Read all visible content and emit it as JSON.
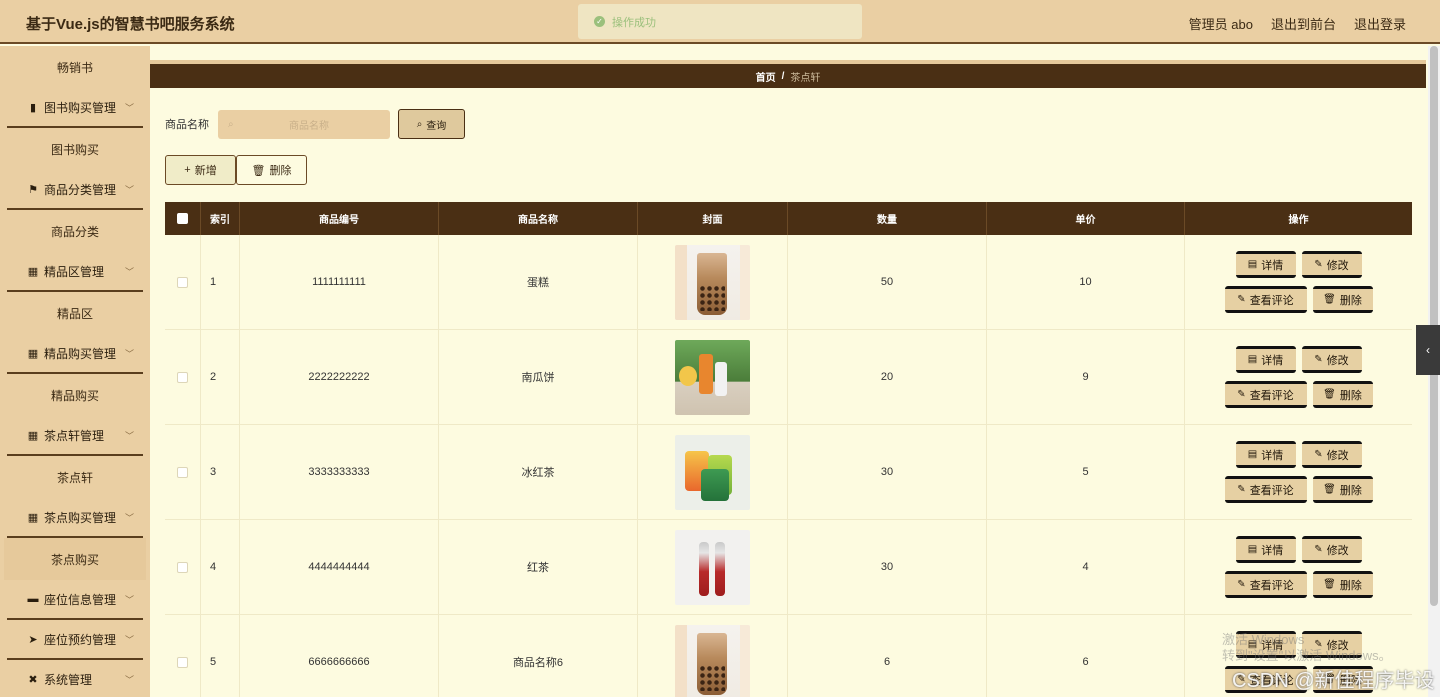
{
  "app": {
    "title": "基于Vue.js的智慧书吧服务系统"
  },
  "header": {
    "user_label": "管理员 abo",
    "front_label": "退出到前台",
    "logout_label": "退出登录"
  },
  "toast": {
    "message": "操作成功"
  },
  "sidebar": {
    "items": [
      {
        "type": "child",
        "label": "畅销书"
      },
      {
        "type": "parent",
        "label": "图书购买管理",
        "icon": "bar-chart-icon"
      },
      {
        "type": "child",
        "label": "图书购买"
      },
      {
        "type": "parent",
        "label": "商品分类管理",
        "icon": "flag-icon"
      },
      {
        "type": "child",
        "label": "商品分类"
      },
      {
        "type": "parent",
        "label": "精品区管理",
        "icon": "grid-icon"
      },
      {
        "type": "child",
        "label": "精品区"
      },
      {
        "type": "parent",
        "label": "精品购买管理",
        "icon": "grid-icon"
      },
      {
        "type": "child",
        "label": "精品购买"
      },
      {
        "type": "parent",
        "label": "茶点轩管理",
        "icon": "grid-icon"
      },
      {
        "type": "child",
        "label": "茶点轩"
      },
      {
        "type": "parent",
        "label": "茶点购买管理",
        "icon": "grid-icon"
      },
      {
        "type": "child",
        "label": "茶点购买",
        "active": true
      },
      {
        "type": "parent",
        "label": "座位信息管理",
        "icon": "briefcase-icon"
      },
      {
        "type": "parent",
        "label": "座位预约管理",
        "icon": "send-icon"
      },
      {
        "type": "parent",
        "label": "系统管理",
        "icon": "settings-icon"
      }
    ]
  },
  "breadcrumb": {
    "home": "首页",
    "separator": "/",
    "current": "茶点轩"
  },
  "search": {
    "label": "商品名称",
    "placeholder": "商品名称",
    "query_label": "查询"
  },
  "actions": {
    "add_label": "新增",
    "delete_label": "删除"
  },
  "table": {
    "headers": [
      "索引",
      "商品编号",
      "商品名称",
      "封面",
      "数量",
      "单价",
      "操作"
    ],
    "rows": [
      {
        "index": "1",
        "code": "1111111111",
        "name": "蛋糕",
        "cover": "milk-tea-image",
        "qty": "50",
        "price": "10"
      },
      {
        "index": "2",
        "code": "2222222222",
        "name": "南瓜饼",
        "cover": "pumpkin-drink-image",
        "qty": "20",
        "price": "9"
      },
      {
        "index": "3",
        "code": "3333333333",
        "name": "冰红茶",
        "cover": "ice-tea-cans-image",
        "qty": "30",
        "price": "5"
      },
      {
        "index": "4",
        "code": "4444444444",
        "name": "红茶",
        "cover": "red-tea-bottles-image",
        "qty": "30",
        "price": "4"
      },
      {
        "index": "5",
        "code": "6666666666",
        "name": "商品名称6",
        "cover": "milk-tea-image",
        "qty": "6",
        "price": "6"
      }
    ],
    "ops": {
      "detail": "详情",
      "edit": "修改",
      "comment": "查看评论",
      "remove": "删除"
    }
  },
  "overlay": {
    "watermark_line1": "激活 Windows",
    "watermark_line2": "转到\"设置\"以激活 Windows。",
    "csdn": "CSDN @新佳程序毕设"
  },
  "colors": {
    "header_bg": "#eacfa3",
    "table_head": "#4a2f14",
    "page_bg": "#fdfbe0",
    "accent_border": "#5a3e1d"
  }
}
